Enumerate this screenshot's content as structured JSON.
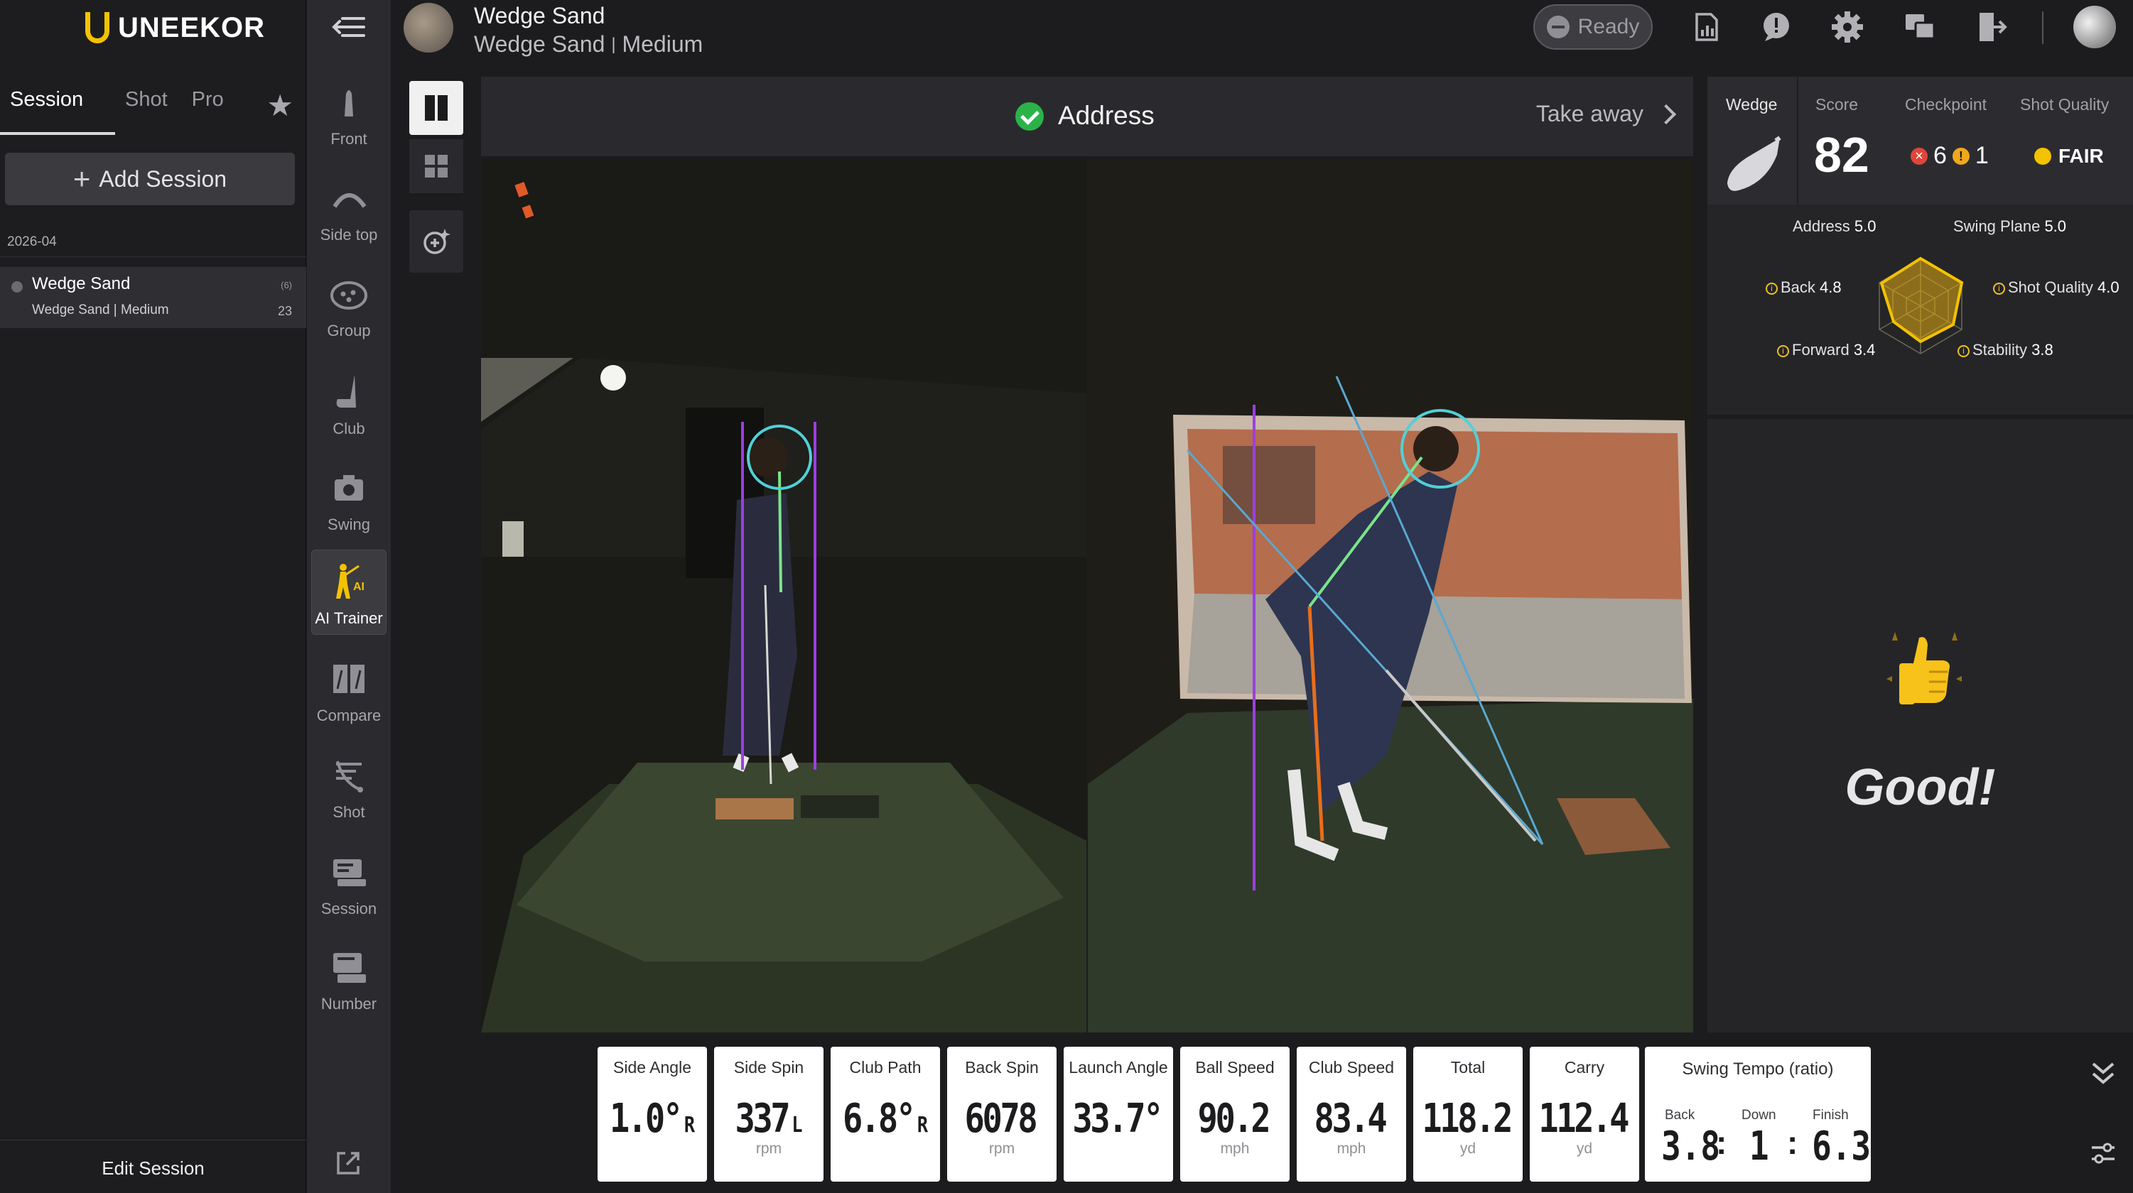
{
  "brand": {
    "name": "UNEEKOR",
    "accent": "#f3c200"
  },
  "left_tabs": [
    {
      "label": "Session",
      "active": true
    },
    {
      "label": "Shot",
      "active": false
    },
    {
      "label": "Pro",
      "active": false
    }
  ],
  "add_session_label": "Add Session",
  "session_group": {
    "date": "2026-04",
    "items": [
      {
        "title": "Wedge Sand",
        "club": "Wedge Sand",
        "separator": "|",
        "level": "Medium",
        "badge": "(6)",
        "count": "23"
      }
    ]
  },
  "edit_session_label": "Edit Session",
  "rail": [
    {
      "label": "Front",
      "icon": "front-view-icon",
      "active": false
    },
    {
      "label": "Side top",
      "icon": "side-top-view-icon",
      "active": false
    },
    {
      "label": "Group",
      "icon": "group-icon",
      "active": false
    },
    {
      "label": "Club",
      "icon": "club-icon",
      "active": false
    },
    {
      "label": "Swing",
      "icon": "camera-icon",
      "active": false
    },
    {
      "label": "AI Trainer",
      "icon": "ai-trainer-icon",
      "active": true
    },
    {
      "label": "Compare",
      "icon": "compare-icon",
      "active": false
    },
    {
      "label": "Shot",
      "icon": "shot-icon",
      "active": false
    },
    {
      "label": "Session",
      "icon": "session-icon",
      "active": false
    },
    {
      "label": "Number",
      "icon": "number-icon",
      "active": false
    }
  ],
  "header": {
    "title": "Wedge Sand",
    "club": "Wedge Sand",
    "separator": "|",
    "level": "Medium",
    "status": "Ready",
    "icons": [
      "report-icon",
      "alert-icon",
      "gear-icon",
      "screens-icon",
      "exit-icon"
    ]
  },
  "step": {
    "current": "Address",
    "next": "Take away"
  },
  "score_panel": {
    "club_label": "Wedge",
    "score_label": "Score",
    "score": "82",
    "checkpoint_label": "Checkpoint",
    "checkpoint_fail": "6",
    "checkpoint_warn": "1",
    "quality_label": "Shot Quality",
    "quality": "FAIR",
    "radar": [
      {
        "name": "Address",
        "value": "5.0",
        "info": false
      },
      {
        "name": "Swing Plane",
        "value": "5.0",
        "info": false
      },
      {
        "name": "Shot Quality",
        "value": "4.0",
        "info": true
      },
      {
        "name": "Stability",
        "value": "3.8",
        "info": true
      },
      {
        "name": "Forward",
        "value": "3.4",
        "info": true
      },
      {
        "name": "Back",
        "value": "4.8",
        "info": true
      }
    ],
    "feedback": "Good!"
  },
  "metrics": [
    {
      "label": "Side Angle",
      "value": "1.0°",
      "dir": "R",
      "unit": ""
    },
    {
      "label": "Side Spin",
      "value": "337",
      "dir": "L",
      "unit": "rpm"
    },
    {
      "label": "Club Path",
      "value": "6.8°",
      "dir": "R",
      "unit": ""
    },
    {
      "label": "Back Spin",
      "value": "6078",
      "dir": "",
      "unit": "rpm"
    },
    {
      "label": "Launch Angle",
      "value": "33.7°",
      "dir": "",
      "unit": ""
    },
    {
      "label": "Ball Speed",
      "value": "90.2",
      "dir": "",
      "unit": "mph"
    },
    {
      "label": "Club Speed",
      "value": "83.4",
      "dir": "",
      "unit": "mph"
    },
    {
      "label": "Total",
      "value": "118.2",
      "dir": "",
      "unit": "yd"
    },
    {
      "label": "Carry",
      "value": "112.4",
      "dir": "",
      "unit": "yd"
    }
  ],
  "tempo": {
    "title": "Swing Tempo (ratio)",
    "back_label": "Back",
    "back": "3.8",
    "down_label": "Down",
    "down": "1",
    "finish_label": "Finish",
    "finish": "6.3"
  }
}
